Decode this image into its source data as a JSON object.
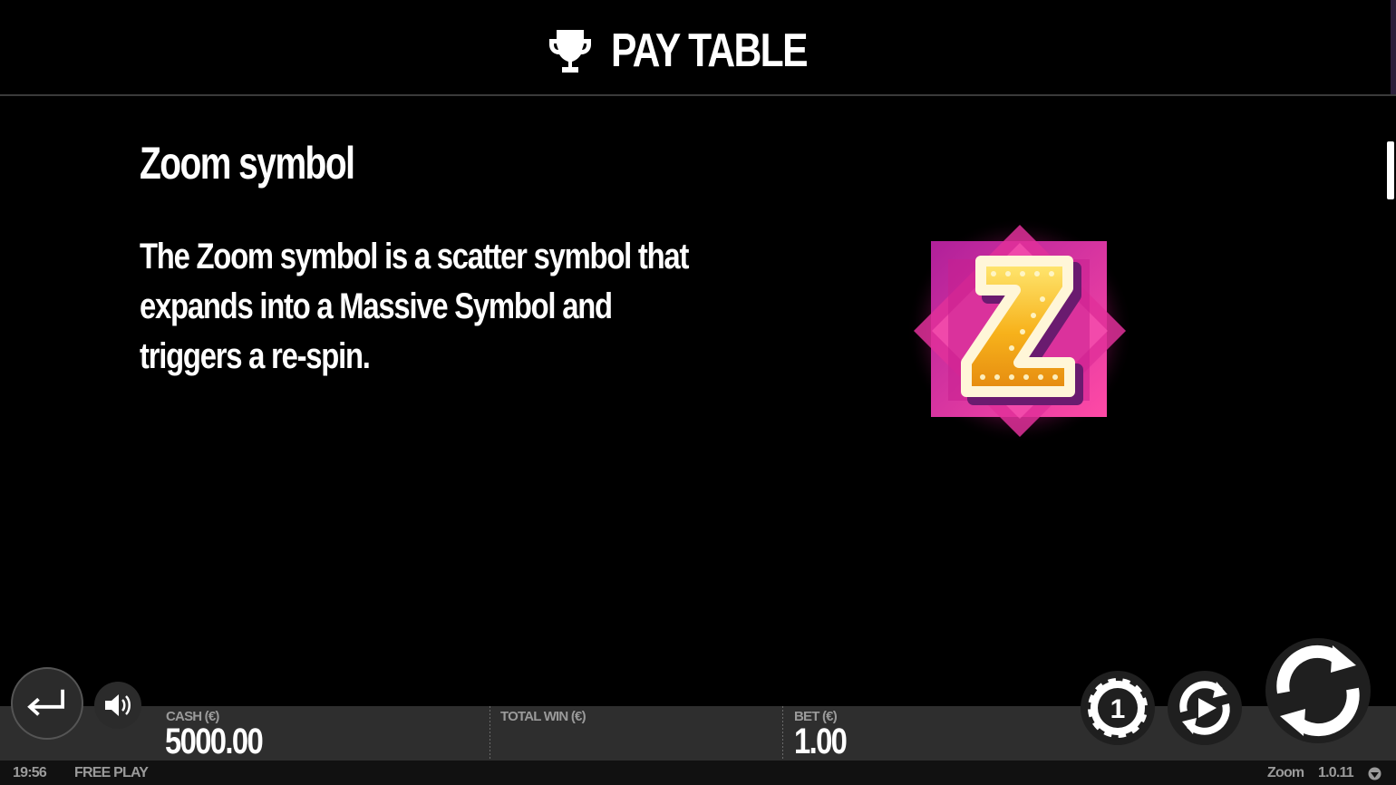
{
  "header": {
    "title": "PAY TABLE",
    "icon": "trophy-icon"
  },
  "content": {
    "heading": "Zoom symbol",
    "body": "The Zoom symbol is a scatter symbol that expands into a Massive Symbol and triggers a re-spin.",
    "symbol": {
      "letter": "Z",
      "icon": "zoom-scatter-symbol"
    }
  },
  "footer": {
    "cash_label": "CASH (€)",
    "cash_value": "5000.00",
    "total_win_label": "TOTAL WIN (€)",
    "total_win_value": "",
    "bet_label": "BET (€)",
    "bet_value": "1.00",
    "coin_value": "1"
  },
  "status": {
    "time": "19:56",
    "mode": "FREE PLAY",
    "game_name": "Zoom",
    "version": "1.0.11"
  },
  "colors": {
    "background": "#000000",
    "bar": "#2e2e2e",
    "accent_pink": "#e0309a",
    "symbol_gold": "#f7b21b"
  }
}
